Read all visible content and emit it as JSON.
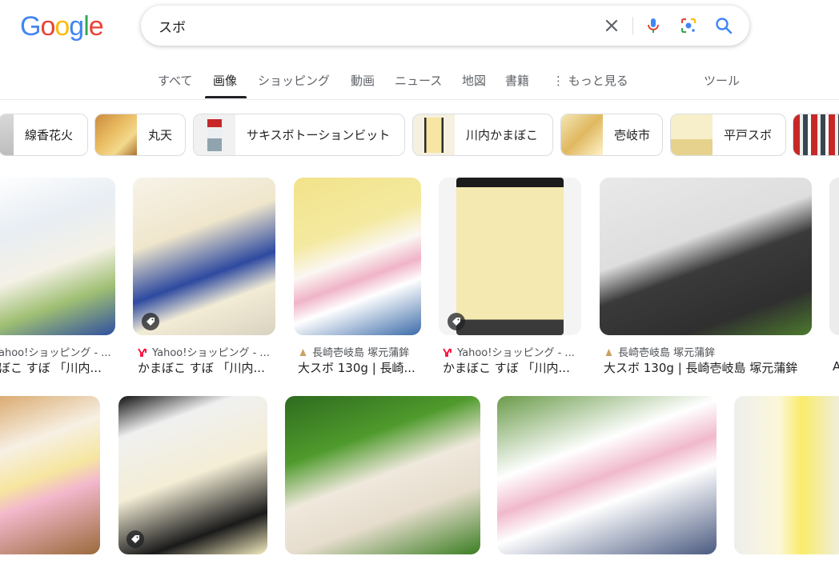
{
  "search": {
    "query": "スボ"
  },
  "tabs": [
    {
      "label": "すべて"
    },
    {
      "label": "画像"
    },
    {
      "label": "ショッピング"
    },
    {
      "label": "動画"
    },
    {
      "label": "ニュース"
    },
    {
      "label": "地図"
    },
    {
      "label": "書籍"
    },
    {
      "label": "もっと見る"
    },
    {
      "label": "ツール"
    }
  ],
  "chips": [
    {
      "label": "線香花火"
    },
    {
      "label": "丸天"
    },
    {
      "label": "サキスボトーションビット"
    },
    {
      "label": "川内かまぼこ"
    },
    {
      "label": "壱岐市"
    },
    {
      "label": "平戸スボ"
    }
  ],
  "row1": [
    {
      "source": "ahoo!ショッピング - ...",
      "title": "ぼこ すぼ 「川内..."
    },
    {
      "source": "Yahoo!ショッピング - ...",
      "title": "かまぼこ すぼ 「川内..."
    },
    {
      "source": "長崎壱岐島 塚元蒲鉾",
      "title": "大スボ 130g | 長崎..."
    },
    {
      "source": "Yahoo!ショッピング - ...",
      "title": "かまぼこ すぼ 「川内..."
    },
    {
      "source": "長崎壱岐島 塚元蒲鉾",
      "title": "大スボ 130g | 長崎壱岐島 塚元蒲鉾"
    },
    {
      "source": "",
      "title": "A"
    }
  ],
  "colors": {
    "accent": "#1a73e8",
    "yahoo": "#ff0033",
    "text": "#202124",
    "muted": "#5f6368"
  }
}
